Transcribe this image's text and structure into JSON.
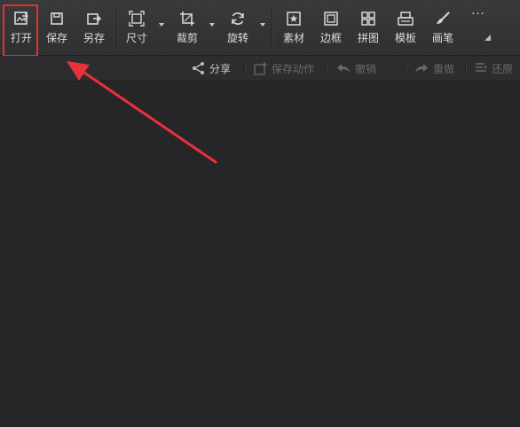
{
  "toolbar": {
    "open": "打开",
    "save": "保存",
    "save_as": "另存",
    "size": "尺寸",
    "crop": "裁剪",
    "rotate": "旋转",
    "material": "素材",
    "border": "边框",
    "collage": "拼图",
    "template": "模板",
    "brush": "画笔",
    "more": "···"
  },
  "subbar": {
    "share": "分享",
    "save_action": "保存动作",
    "undo": "撤销",
    "redo": "重做",
    "restore": "还原"
  },
  "colors": {
    "highlight": "#e03232",
    "arrow": "#e8323a"
  }
}
